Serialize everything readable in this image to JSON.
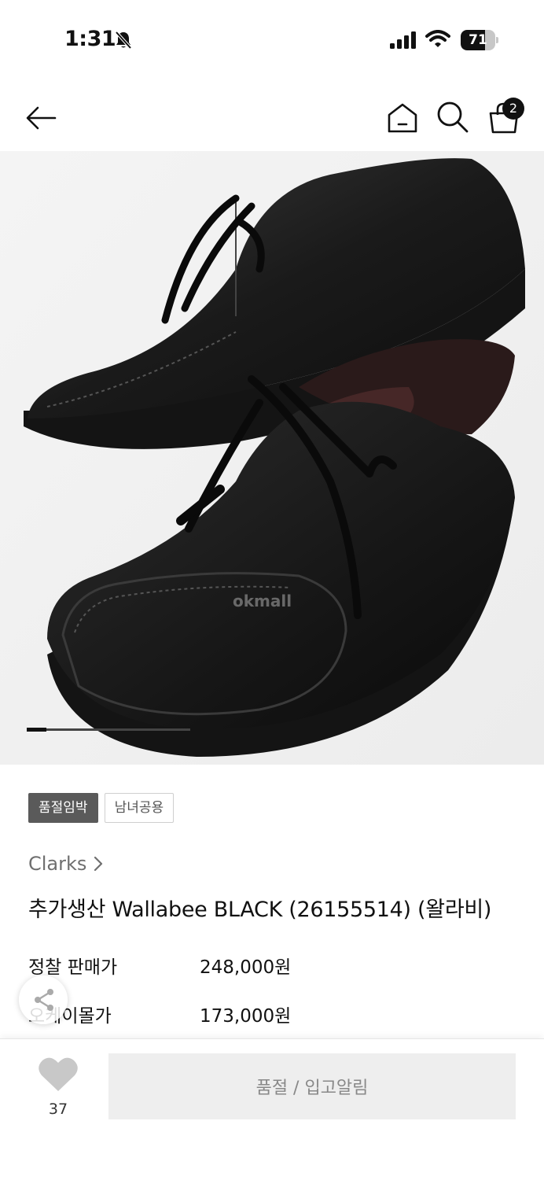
{
  "status_bar": {
    "time": "1:31",
    "battery_level": 71,
    "battery_text": "71"
  },
  "header": {
    "cart_count": "2",
    "icons": [
      "back-arrow-icon",
      "home-icon",
      "search-icon",
      "shopping-bag-icon"
    ]
  },
  "hero": {
    "watermark": "okmall",
    "carousel_progress": 0.12
  },
  "product": {
    "badges": [
      "품절임박",
      "남녀공용"
    ],
    "brand": "Clarks",
    "title": "추가생산 Wallabee BLACK (26155514) (왈라비)",
    "prices": [
      {
        "label": "정찰 판매가",
        "value": "248,000원"
      },
      {
        "label": "오케이몰가",
        "value": "173,000원"
      }
    ]
  },
  "bottom_bar": {
    "like_count": "37",
    "soldout_label": "품절 / 입고알림"
  },
  "colors": {
    "accent_dark": "#111111",
    "badge_dark": "#5a5a5a",
    "button_disabled_bg": "#eeeeee",
    "heart": "#c8c8c8"
  }
}
